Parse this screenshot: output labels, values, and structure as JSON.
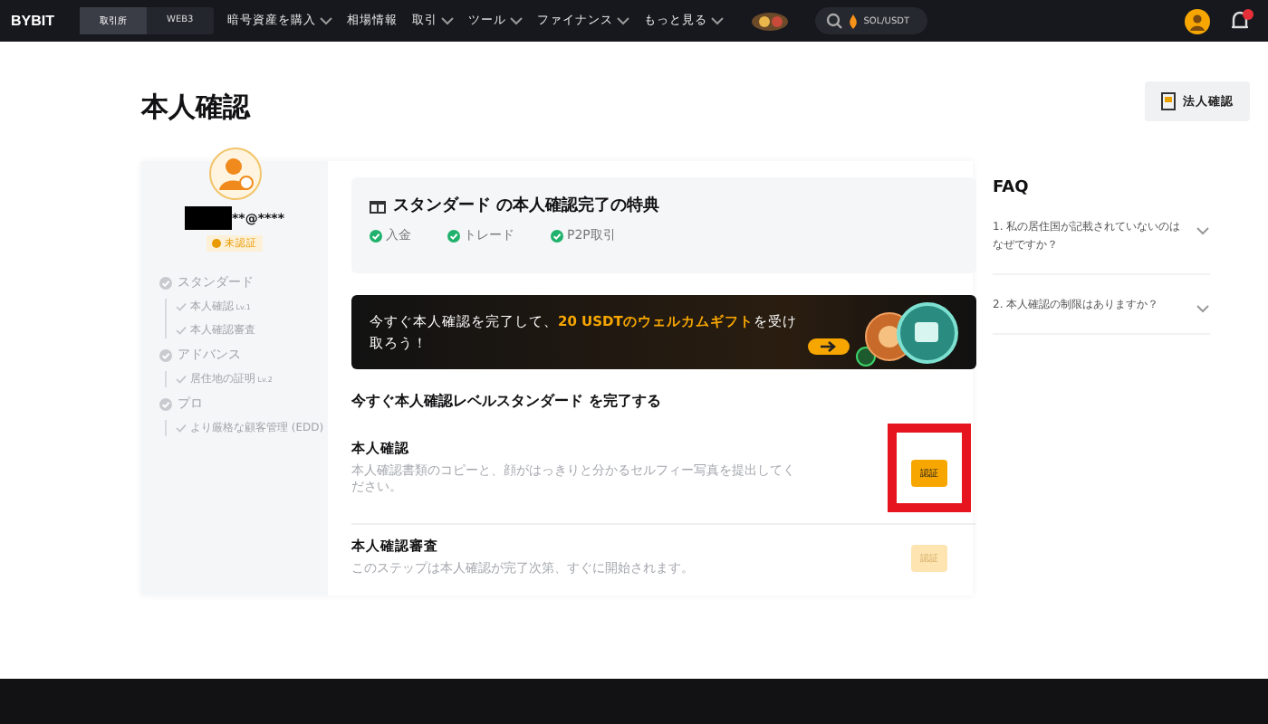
{
  "header": {
    "logo": "BYBIT",
    "tabs": [
      {
        "label": "取引所",
        "selected": true
      },
      {
        "label": "WEB3",
        "selected": false
      }
    ],
    "nav": [
      {
        "label": "暗号資産を購入",
        "dropdown": true
      },
      {
        "label": "相場情報",
        "dropdown": false
      },
      {
        "label": "取引",
        "dropdown": true
      },
      {
        "label": "ツール",
        "dropdown": true
      },
      {
        "label": "ファイナンス",
        "dropdown": true
      },
      {
        "label": "もっと見る",
        "dropdown": true
      }
    ],
    "search": {
      "value": "SOL/USDT"
    }
  },
  "page": {
    "title": "本人確認",
    "corporate_button": "法人確認"
  },
  "profile": {
    "email": "**@****",
    "status": "未認証"
  },
  "levels": [
    {
      "label": "スタンダード",
      "children": [
        {
          "label": "本人確認",
          "tag": "Lv.1"
        },
        {
          "label": "本人確認審査"
        }
      ]
    },
    {
      "label": "アドバンス",
      "children": [
        {
          "label": "居住地の証明",
          "tag": "Lv.2"
        }
      ]
    },
    {
      "label": "プロ",
      "children": [
        {
          "label": "より厳格な顧客管理 (EDD)"
        }
      ]
    }
  ],
  "benefits": {
    "title": "スタンダード の本人確認完了の特典",
    "items": [
      "入金",
      "トレード",
      "P2P取引"
    ]
  },
  "banner": {
    "text": "今すぐ本人確認を完了して、",
    "highlight": "20 USDTのウェルカムギフト",
    "text_end": "を受け取ろう！"
  },
  "steps_heading": "今すぐ本人確認レベルスタンダード を完了する",
  "steps": [
    {
      "title": "本人確認",
      "description": "本人確認書類のコピーと、顔がはっきりと分かるセルフィー写真を提出してください。",
      "button": "認証",
      "disabled": false,
      "highlighted": true
    },
    {
      "title": "本人確認審査",
      "description": "このステップは本人確認が完了次第、すぐに開始されます。",
      "button": "認証",
      "disabled": true,
      "highlighted": false
    }
  ],
  "faq": {
    "title": "FAQ",
    "items": [
      "1. 私の居住国が記載されていないのはなぜですか？",
      "2. 本人確認の制限はありますか？"
    ]
  }
}
